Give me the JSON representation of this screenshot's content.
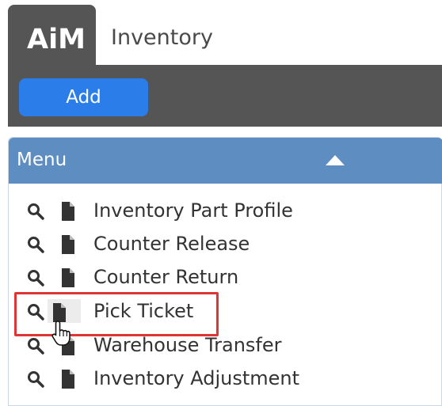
{
  "header": {
    "logo_text": "AiM",
    "app_title": "Inventory"
  },
  "toolbar": {
    "add_label": "Add"
  },
  "menu": {
    "title": "Menu",
    "collapse_icon": "caret-up-icon",
    "items": [
      {
        "label": "Inventory Part Profile"
      },
      {
        "label": "Counter Release"
      },
      {
        "label": "Counter Return"
      },
      {
        "label": "Pick Ticket",
        "highlighted": true
      },
      {
        "label": "Warehouse Transfer"
      },
      {
        "label": "Inventory Adjustment"
      }
    ]
  },
  "icons": {
    "search": "search-icon",
    "document": "document-icon",
    "cursor": "hand-pointer-cursor"
  },
  "colors": {
    "dark_bar": "#555555",
    "add_button": "#2b7de9",
    "menu_header": "#5e8dc2",
    "highlight": "#e03535"
  }
}
